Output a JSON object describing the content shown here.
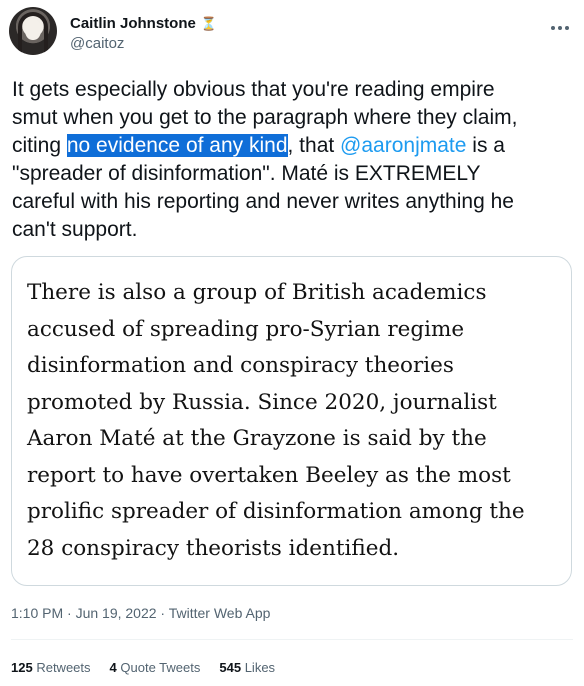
{
  "author": {
    "name": "Caitlin Johnstone",
    "handle": "@caitoz",
    "badge_icon": "hourglass-icon"
  },
  "tweet": {
    "line1": "It gets especially obvious that you're reading empire",
    "line2": "smut when you get to the paragraph where they claim,",
    "line3_pre": "citing ",
    "line3_highlight": "no evidence of any kind",
    "line3_mid": ", that ",
    "line3_mention": "@aaronjmate",
    "line3_post": " is a",
    "line4": "\"spreader of disinformation\". Maté is EXTREMELY",
    "line5": "careful with his reporting and never writes anything he",
    "line6": "can't support."
  },
  "quote": {
    "lines": [
      "There is also a group of British academics",
      "accused of spreading pro-Syrian regime",
      "disinformation and conspiracy theories",
      "promoted by Russia. Since 2020, journalist",
      "Aaron Maté at the Grayzone is said by the",
      "report to have overtaken Beeley as the most",
      "prolific spreader of disinformation among the",
      "28 conspiracy theorists identified."
    ]
  },
  "meta": {
    "timestamp": "1:10 PM · Jun 19, 2022 · Twitter Web App"
  },
  "stats": {
    "retweets_count": "125",
    "retweets_label": "Retweets",
    "quotes_count": "4",
    "quotes_label": "Quote Tweets",
    "likes_count": "545",
    "likes_label": "Likes"
  },
  "colors": {
    "link": "#1d9bf0",
    "selection": "#0f6ed8",
    "secondary_text": "#536471"
  }
}
